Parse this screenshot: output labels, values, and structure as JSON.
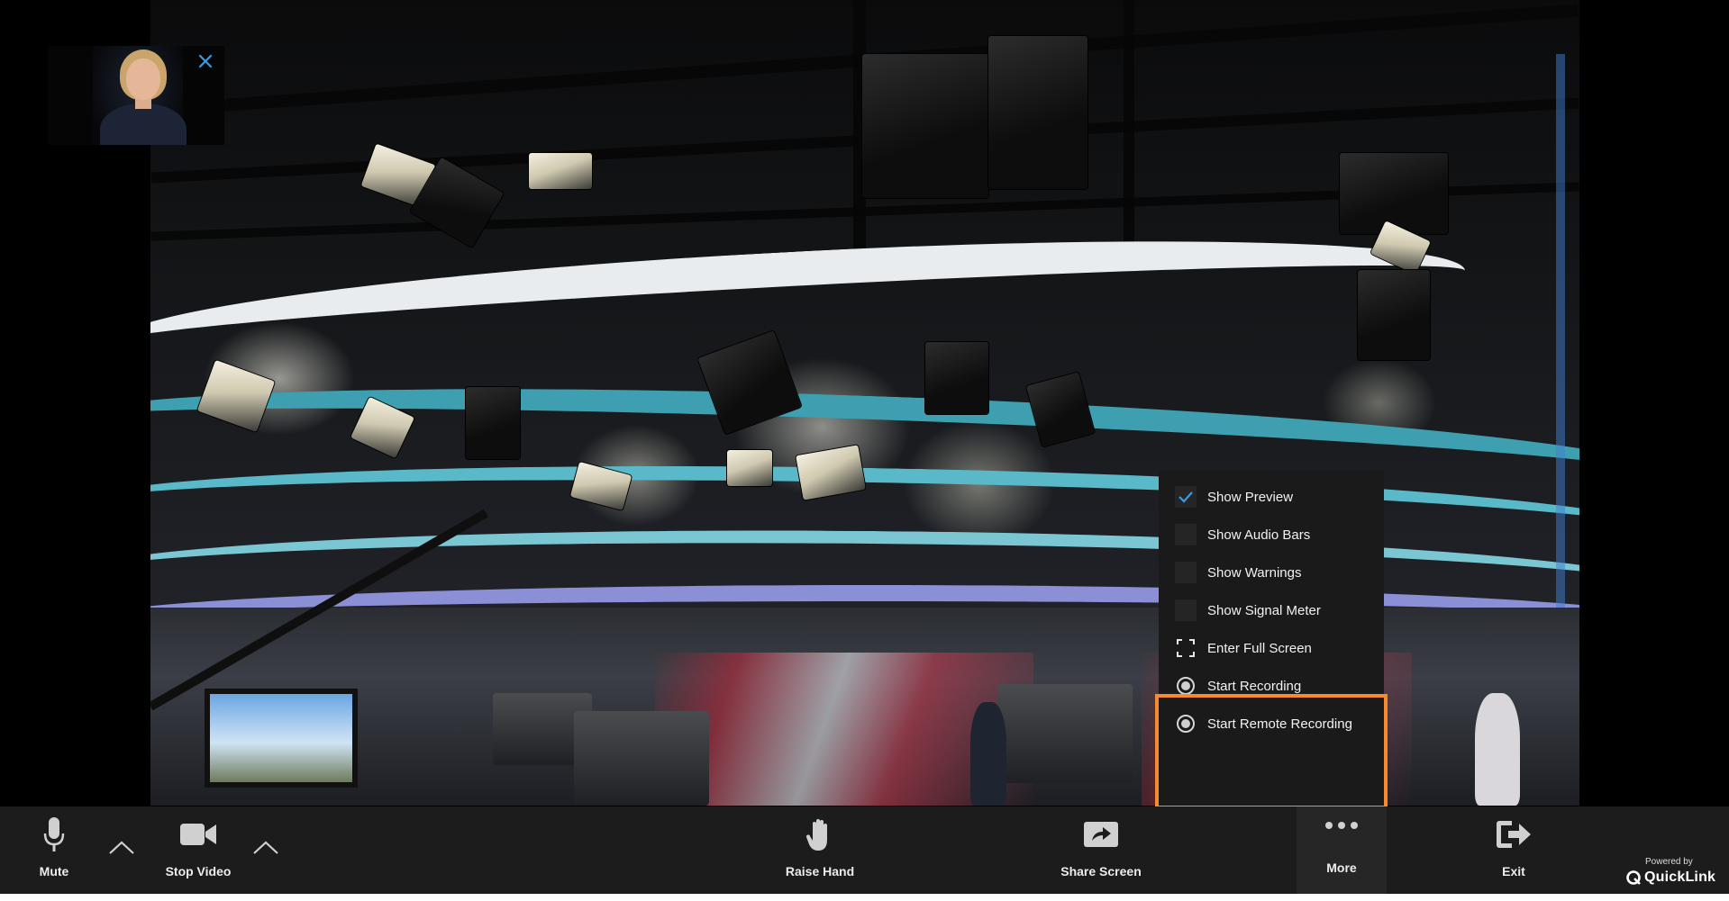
{
  "preview": {
    "close_icon": "close-icon"
  },
  "menu": {
    "items": [
      {
        "label": "Show Preview",
        "control": "checkbox",
        "checked": true,
        "icon": "check-icon"
      },
      {
        "label": "Show Audio Bars",
        "control": "checkbox",
        "checked": false
      },
      {
        "label": "Show Warnings",
        "control": "checkbox",
        "checked": false
      },
      {
        "label": "Show Signal Meter",
        "control": "checkbox",
        "checked": false
      },
      {
        "label": "Enter Full Screen",
        "control": "icon",
        "icon": "fullscreen-icon"
      },
      {
        "label": "Start Recording",
        "control": "radio",
        "icon": "record-radio-icon"
      },
      {
        "label": "Start Remote Recording",
        "control": "radio",
        "icon": "record-radio-icon"
      }
    ],
    "highlight_color": "#f7892f"
  },
  "toolbar": {
    "mute_label": "Mute",
    "stop_video_label": "Stop Video",
    "raise_hand_label": "Raise Hand",
    "share_screen_label": "Share Screen",
    "more_label": "More",
    "exit_label": "Exit",
    "background": "#1c1c1c"
  },
  "branding": {
    "powered_by": "Powered by",
    "name": "QuickLink"
  }
}
